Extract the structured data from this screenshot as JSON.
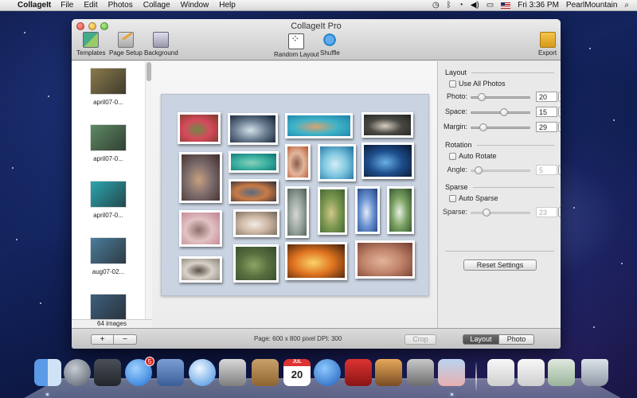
{
  "menubar": {
    "app_name": "CollageIt",
    "items": [
      "File",
      "Edit",
      "Photos",
      "Collage",
      "Window",
      "Help"
    ],
    "clock": "Fri 3:36 PM",
    "user": "PearlMountain"
  },
  "window": {
    "title": "CollageIt Pro",
    "toolbar": {
      "templates": "Templates",
      "page_setup": "Page Setup",
      "background": "Background",
      "random_layout": "Random Layout",
      "shuffle": "Shuffle",
      "export": "Export"
    }
  },
  "sidebar": {
    "thumbnails": [
      {
        "label": "april07-0...",
        "color": "#8a7a4a"
      },
      {
        "label": "april07-0...",
        "color": "#5d8a63"
      },
      {
        "label": "april07-0...",
        "color": "#2aa6b0"
      },
      {
        "label": "aug07-02...",
        "color": "#4b7c9a"
      },
      {
        "label": "",
        "color": "#3d5f7d"
      }
    ],
    "count": "64 images"
  },
  "collage": {
    "background_color": "#c9d3e1",
    "photos": [
      {
        "name": "red-flower",
        "colors": [
          "#7a3a2a",
          "#d64a5c",
          "#6e8a45"
        ]
      },
      {
        "name": "comet-sky",
        "colors": [
          "#0d1a2c",
          "#6c7f92",
          "#d6e2ea"
        ]
      },
      {
        "name": "coral-reef",
        "colors": [
          "#1d7fa8",
          "#3fb3c8",
          "#d7a373"
        ]
      },
      {
        "name": "aerial-terrain",
        "colors": [
          "#202020",
          "#4a4a44",
          "#d8cfc2"
        ]
      },
      {
        "name": "cave-sunset",
        "colors": [
          "#3e2a26",
          "#7b6b6c",
          "#c7a07f"
        ]
      },
      {
        "name": "turtle-sea",
        "colors": [
          "#0a6f6f",
          "#3db1a2",
          "#8ad0b8"
        ]
      },
      {
        "name": "red-canyon",
        "colors": [
          "#b8542b",
          "#e2b59d",
          "#8b5d48"
        ]
      },
      {
        "name": "ice-cave",
        "colors": [
          "#1b6d9a",
          "#7ec6e0",
          "#d5eef6"
        ]
      },
      {
        "name": "earth-orbit",
        "colors": [
          "#0b1429",
          "#1d4e8c",
          "#6ab0e3"
        ]
      },
      {
        "name": "lake-sunset",
        "colors": [
          "#2b2b3a",
          "#c97b45",
          "#5a6a82"
        ]
      },
      {
        "name": "misty-falls",
        "colors": [
          "#4b5a52",
          "#9aa6a0",
          "#d4d8d0"
        ]
      },
      {
        "name": "green-gorge",
        "colors": [
          "#3d5e2d",
          "#7c9850",
          "#d2c68b"
        ]
      },
      {
        "name": "blue-iris",
        "colors": [
          "#1d3f7a",
          "#6a92d1",
          "#e4ecf8"
        ]
      },
      {
        "name": "waterfall",
        "colors": [
          "#2c4a2d",
          "#79a160",
          "#e8efe6"
        ]
      },
      {
        "name": "pink-desert",
        "colors": [
          "#c07f90",
          "#e2c3c4",
          "#8f6f6a"
        ]
      },
      {
        "name": "snowy-peak",
        "colors": [
          "#6d6257",
          "#cdb6a3",
          "#f2ece4"
        ]
      },
      {
        "name": "stones",
        "colors": [
          "#8a8176",
          "#d8d2c8",
          "#5a5147"
        ]
      },
      {
        "name": "green-river",
        "colors": [
          "#354a2e",
          "#58703f",
          "#8ea465"
        ]
      },
      {
        "name": "campfire",
        "colors": [
          "#3a1d0c",
          "#e0731f",
          "#f9d36a"
        ]
      },
      {
        "name": "red-algae",
        "colors": [
          "#6f3a2c",
          "#c1846a",
          "#e2b49a"
        ]
      }
    ]
  },
  "inspector": {
    "layout": {
      "title": "Layout",
      "use_all_photos": "Use All Photos",
      "photo_label": "Photo:",
      "photo_value": "20",
      "space_label": "Space:",
      "space_value": "15",
      "margin_label": "Margin:",
      "margin_value": "29"
    },
    "rotation": {
      "title": "Rotation",
      "auto_rotate": "Auto Rotate",
      "angle_label": "Angle:",
      "angle_value": "5"
    },
    "sparse": {
      "title": "Sparse",
      "auto_sparse": "Auto Sparse",
      "sparse_label": "Sparse:",
      "sparse_value": "23"
    },
    "reset_label": "Reset Settings"
  },
  "bottombar": {
    "add": "+",
    "remove": "−",
    "page_info": "Page: 600 x 800 pixel DPI: 300",
    "crop": "Crop",
    "view_layout": "Layout",
    "view_photo": "Photo"
  },
  "dock": {
    "app_store_badge": "5",
    "calendar_month": "JUL",
    "calendar_day": "20"
  }
}
